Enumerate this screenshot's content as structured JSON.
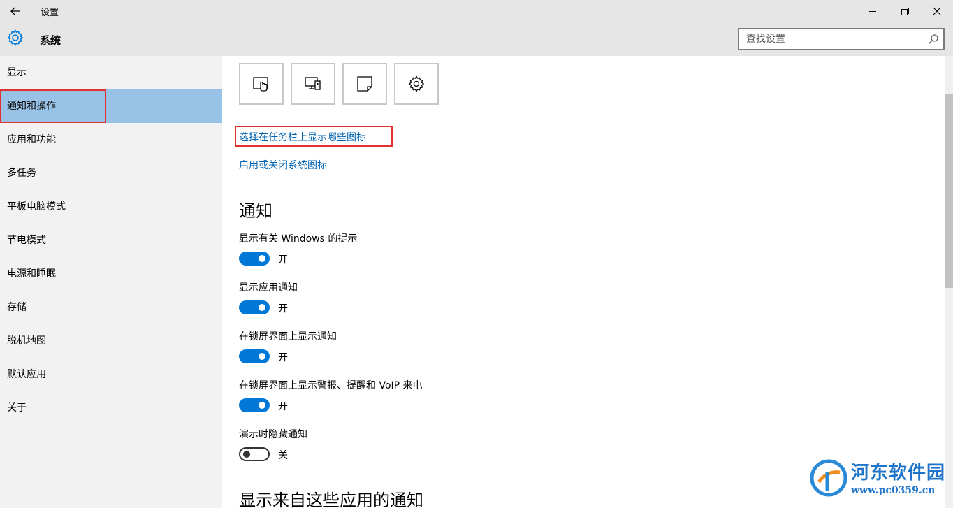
{
  "window": {
    "title": "设置"
  },
  "header": {
    "section_title": "系统",
    "search_placeholder": "查找设置"
  },
  "sidebar": {
    "items": [
      {
        "label": "显示"
      },
      {
        "label": "通知和操作",
        "selected": true
      },
      {
        "label": "应用和功能"
      },
      {
        "label": "多任务"
      },
      {
        "label": "平板电脑模式"
      },
      {
        "label": "节电模式"
      },
      {
        "label": "电源和睡眠"
      },
      {
        "label": "存储"
      },
      {
        "label": "脱机地图"
      },
      {
        "label": "默认应用"
      },
      {
        "label": "关于"
      }
    ]
  },
  "main": {
    "quick_actions": [
      {
        "icon": "tablet-mode-icon"
      },
      {
        "icon": "project-icon"
      },
      {
        "icon": "note-icon"
      },
      {
        "icon": "settings-gear-icon"
      }
    ],
    "links": {
      "taskbar_icons": "选择在任务栏上显示哪些图标",
      "system_icons": "启用或关闭系统图标"
    },
    "notifications": {
      "title": "通知",
      "settings": [
        {
          "label": "显示有关 Windows 的提示",
          "state": "开",
          "on": true
        },
        {
          "label": "显示应用通知",
          "state": "开",
          "on": true
        },
        {
          "label": "在锁屏界面上显示通知",
          "state": "开",
          "on": true
        },
        {
          "label": "在锁屏界面上显示警报、提醒和 VoIP 来电",
          "state": "开",
          "on": true
        },
        {
          "label": "演示时隐藏通知",
          "state": "关",
          "on": false
        }
      ]
    },
    "apps_section_title": "显示来自这些应用的通知"
  },
  "watermark": {
    "name": "河东软件园",
    "url": "www.pc0359.cn"
  },
  "colors": {
    "accent": "#0078d7",
    "link": "#0063b1",
    "selected_nav": "#99c3e6",
    "highlight_box": "#e0302f"
  }
}
